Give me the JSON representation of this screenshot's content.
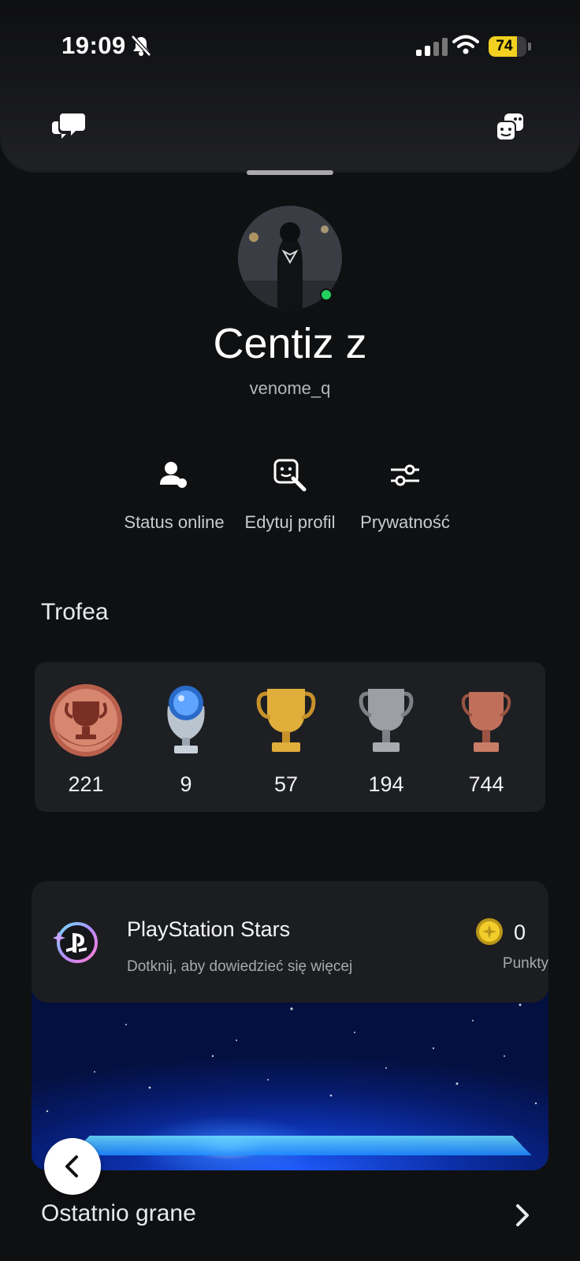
{
  "status_bar": {
    "time": "19:09",
    "battery": "74",
    "battery_level": 0.74,
    "icons": [
      "bell-muted-icon",
      "signal-icon",
      "wifi-icon",
      "battery-icon"
    ]
  },
  "header": {
    "left_icon": "chat-bubbles-icon",
    "right_icon": "friends-icon"
  },
  "profile": {
    "name": "Centiz z",
    "handle": "venome_q",
    "online": true
  },
  "actions": [
    {
      "label": "Status online",
      "icon": "online-status-icon"
    },
    {
      "label": "Edytuj profil",
      "icon": "edit-profile-icon"
    },
    {
      "label": "Prywatność",
      "icon": "privacy-sliders-icon"
    }
  ],
  "trophies": {
    "title": "Trofea",
    "items": [
      {
        "type": "level",
        "count": "221"
      },
      {
        "type": "platinum",
        "count": "9"
      },
      {
        "type": "gold",
        "count": "57"
      },
      {
        "type": "silver",
        "count": "194"
      },
      {
        "type": "bronze",
        "count": "744"
      }
    ]
  },
  "stars": {
    "title": "PlayStation Stars",
    "subtitle": "Dotknij, aby dowiedzieć się więcej",
    "points_value": "0",
    "points_label": "Punkty"
  },
  "recent": {
    "title": "Ostatnio grane"
  },
  "colors": {
    "background": "#0f1012",
    "card": "#1e1f22",
    "online": "#23d160",
    "battery": "#f1d01f",
    "gold": "#d9a830",
    "bronze": "#c0705a"
  }
}
